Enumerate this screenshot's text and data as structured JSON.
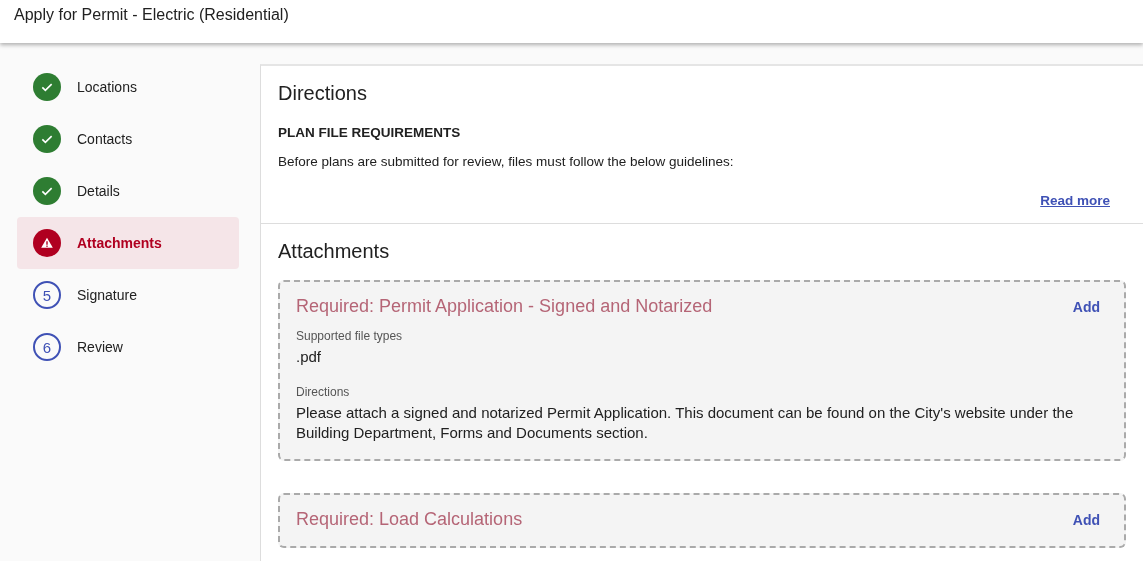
{
  "header": {
    "title": "Apply for Permit - Electric (Residential)"
  },
  "steps": [
    {
      "label": "Locations",
      "kind": "done",
      "selected": false
    },
    {
      "label": "Contacts",
      "kind": "done",
      "selected": false
    },
    {
      "label": "Details",
      "kind": "done",
      "selected": false
    },
    {
      "label": "Attachments",
      "kind": "error",
      "selected": true
    },
    {
      "label": "Signature",
      "kind": "pending",
      "number": "5",
      "selected": false
    },
    {
      "label": "Review",
      "kind": "pending",
      "number": "6",
      "selected": false
    }
  ],
  "directions": {
    "title": "Directions",
    "subtitle": "PLAN FILE REQUIREMENTS",
    "text": "Before plans are submitted for review, files must follow the below guidelines:",
    "link": "Read more"
  },
  "attachments": {
    "title": "Attachments",
    "items": [
      {
        "title": "Required: Permit Application - Signed and Notarized",
        "action": "Add",
        "types_label": "Supported file types",
        "types": ".pdf",
        "directions_label": "Directions",
        "directions": "Please attach a signed and notarized Permit Application. This document can be found on the City's website under the Building Department, Forms and Documents section."
      },
      {
        "title": "Required: Load Calculations",
        "action": "Add"
      }
    ]
  }
}
